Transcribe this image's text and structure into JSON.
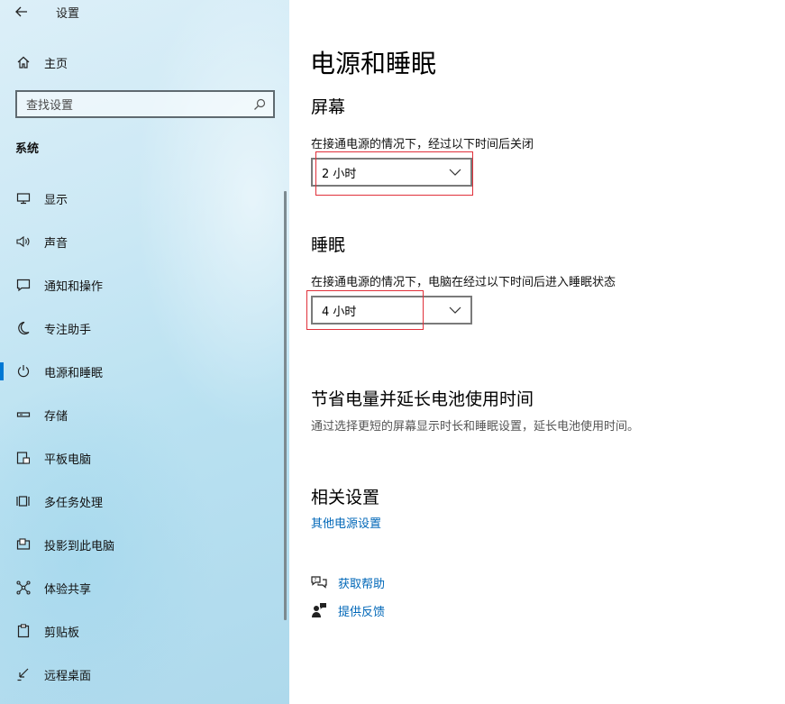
{
  "window": {
    "title": "设置",
    "back_icon": "back-arrow-icon"
  },
  "sidebar": {
    "home_label": "主页",
    "search_placeholder": "查找设置",
    "section_heading": "系统",
    "items": [
      {
        "label": "显示",
        "icon": "monitor-icon"
      },
      {
        "label": "声音",
        "icon": "speaker-icon"
      },
      {
        "label": "通知和操作",
        "icon": "notification-icon"
      },
      {
        "label": "专注助手",
        "icon": "moon-icon"
      },
      {
        "label": "电源和睡眠",
        "icon": "power-icon",
        "active": true
      },
      {
        "label": "存储",
        "icon": "storage-icon"
      },
      {
        "label": "平板电脑",
        "icon": "tablet-icon"
      },
      {
        "label": "多任务处理",
        "icon": "multitask-icon"
      },
      {
        "label": "投影到此电脑",
        "icon": "project-icon"
      },
      {
        "label": "体验共享",
        "icon": "share-icon"
      },
      {
        "label": "剪贴板",
        "icon": "clipboard-icon"
      },
      {
        "label": "远程桌面",
        "icon": "remote-desktop-icon"
      }
    ]
  },
  "main": {
    "title": "电源和睡眠",
    "screen": {
      "heading": "屏幕",
      "description": "在接通电源的情况下，经过以下时间后关闭",
      "value": "2 小时"
    },
    "sleep": {
      "heading": "睡眠",
      "description": "在接通电源的情况下，电脑在经过以下时间后进入睡眠状态",
      "value": "4 小时"
    },
    "battery": {
      "heading": "节省电量并延长电池使用时间",
      "description": "通过选择更短的屏幕显示时长和睡眠设置，延长电池使用时间。"
    },
    "related": {
      "heading": "相关设置",
      "link": "其他电源设置"
    },
    "help": {
      "get_help": "获取帮助",
      "feedback": "提供反馈"
    }
  },
  "colors": {
    "accent": "#0078d4",
    "link": "#0067b8",
    "highlight": "#e0303a"
  }
}
